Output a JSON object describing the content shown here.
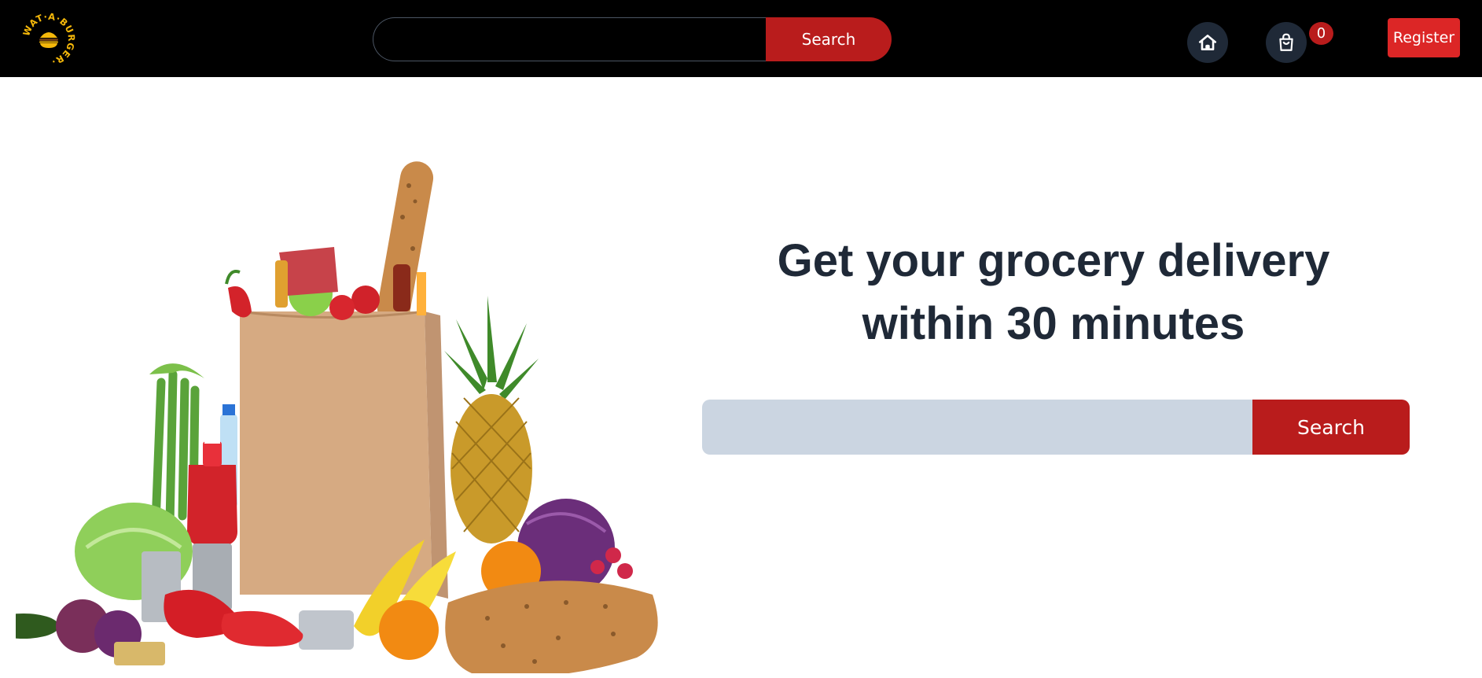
{
  "brand": {
    "logo_text": "WAT-A-BURGER",
    "logo_icon": "burger-icon",
    "colors": {
      "navbar": "#000000",
      "accent": "#b91c1c",
      "register": "#dc2626",
      "logo": "#f5b80a"
    }
  },
  "navbar": {
    "search_value": "",
    "search_button": "Search",
    "home_icon": "home-icon",
    "cart_icon": "shopping-bag-icon",
    "cart_count": "0",
    "register_label": "Register"
  },
  "hero": {
    "title_line1": "Get your grocery delivery",
    "title_line2": "within 30 minutes",
    "search_value": "",
    "search_button": "Search",
    "image": "grocery-bag-illustration"
  }
}
